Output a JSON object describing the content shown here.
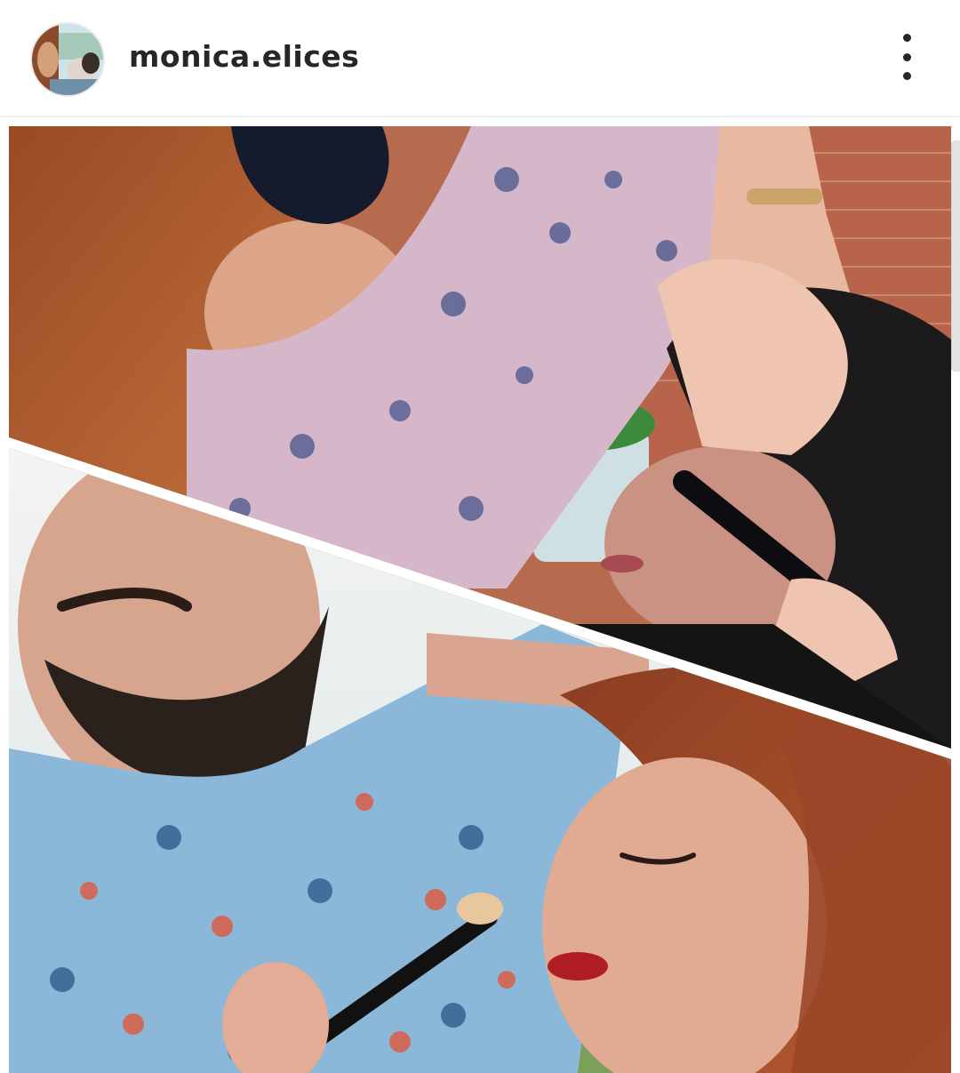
{
  "post": {
    "username": "monica.elices",
    "avatar_icon": "profile-avatar",
    "menu_icon": "more-vertical-icon"
  },
  "colors": {
    "text": "#262626",
    "divider": "#e9f2f2"
  }
}
